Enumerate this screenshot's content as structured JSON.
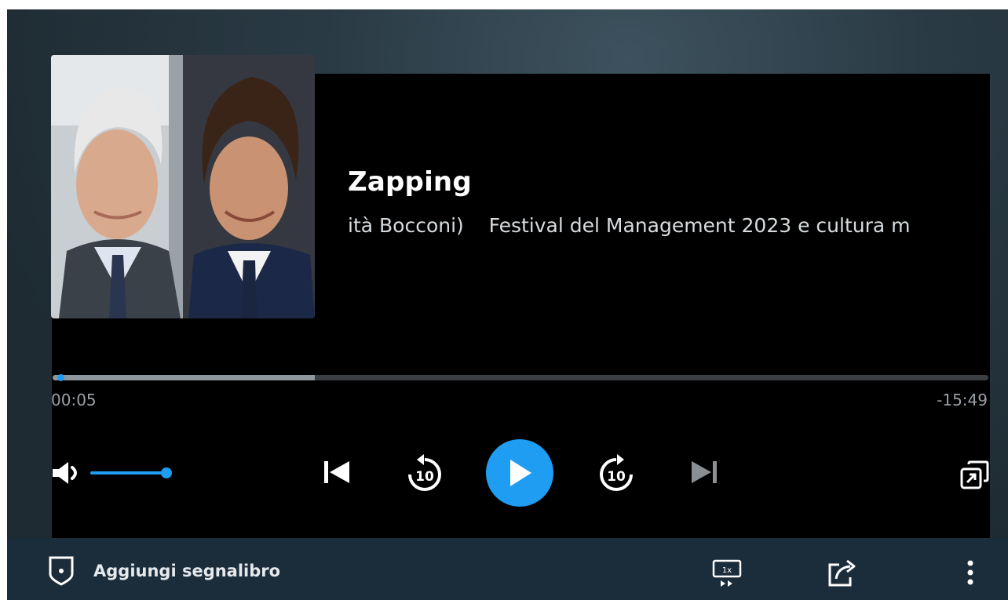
{
  "episode": {
    "title": "Zapping",
    "subtitle": "ità Bocconi)    Festival del Management 2023 e cultura m"
  },
  "progress": {
    "current_time": "00:05",
    "remaining_time": "-15:49",
    "played_fraction": 0.005,
    "buffered_fraction": 0.28
  },
  "volume": {
    "level": 1.0
  },
  "controls": {
    "icons": [
      "volume-icon",
      "skip-previous-icon",
      "replay-10-icon",
      "play-icon",
      "forward-10-icon",
      "skip-next-icon",
      "popout-icon"
    ],
    "replay_seconds": "10",
    "forward_seconds": "10"
  },
  "bottom_bar": {
    "bookmark_label": "Aggiungi segnalibro",
    "speed_label": "1x"
  },
  "colors": {
    "accent": "#1e9df2",
    "player_bg": "#000000",
    "bar_bg": "#1b2c3a"
  }
}
